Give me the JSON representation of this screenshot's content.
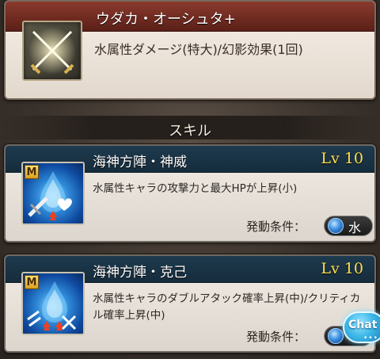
{
  "ougi": {
    "title": "ウダカ・オーシュタ+",
    "description": "水属性ダメージ(特大)/幻影効果(1回)",
    "icon": "crossed-swords-icon"
  },
  "section_label": "スキル",
  "skills": [
    {
      "badge": "M",
      "name": "海神方陣・神威",
      "level": "Lv 10",
      "description": "水属性キャラの攻撃力と最大HPが上昇(小)",
      "condition_label": "発動条件：",
      "element": "水",
      "icon": "water-sword-heart-icon"
    },
    {
      "badge": "M",
      "name": "海神方陣・克己",
      "level": "Lv 10",
      "description": "水属性キャラのダブルアタック確率上昇(中)/クリティカル確率上昇(中)",
      "condition_label": "発動条件：",
      "icon": "water-crit-icon"
    }
  ],
  "chat": {
    "label": "Chat",
    "dots": "•••"
  },
  "colors": {
    "ougi_header": "#6e2a20",
    "skill_header": "#152c3c",
    "level_text": "#ffe050",
    "water_element": "#3b8fe0"
  }
}
